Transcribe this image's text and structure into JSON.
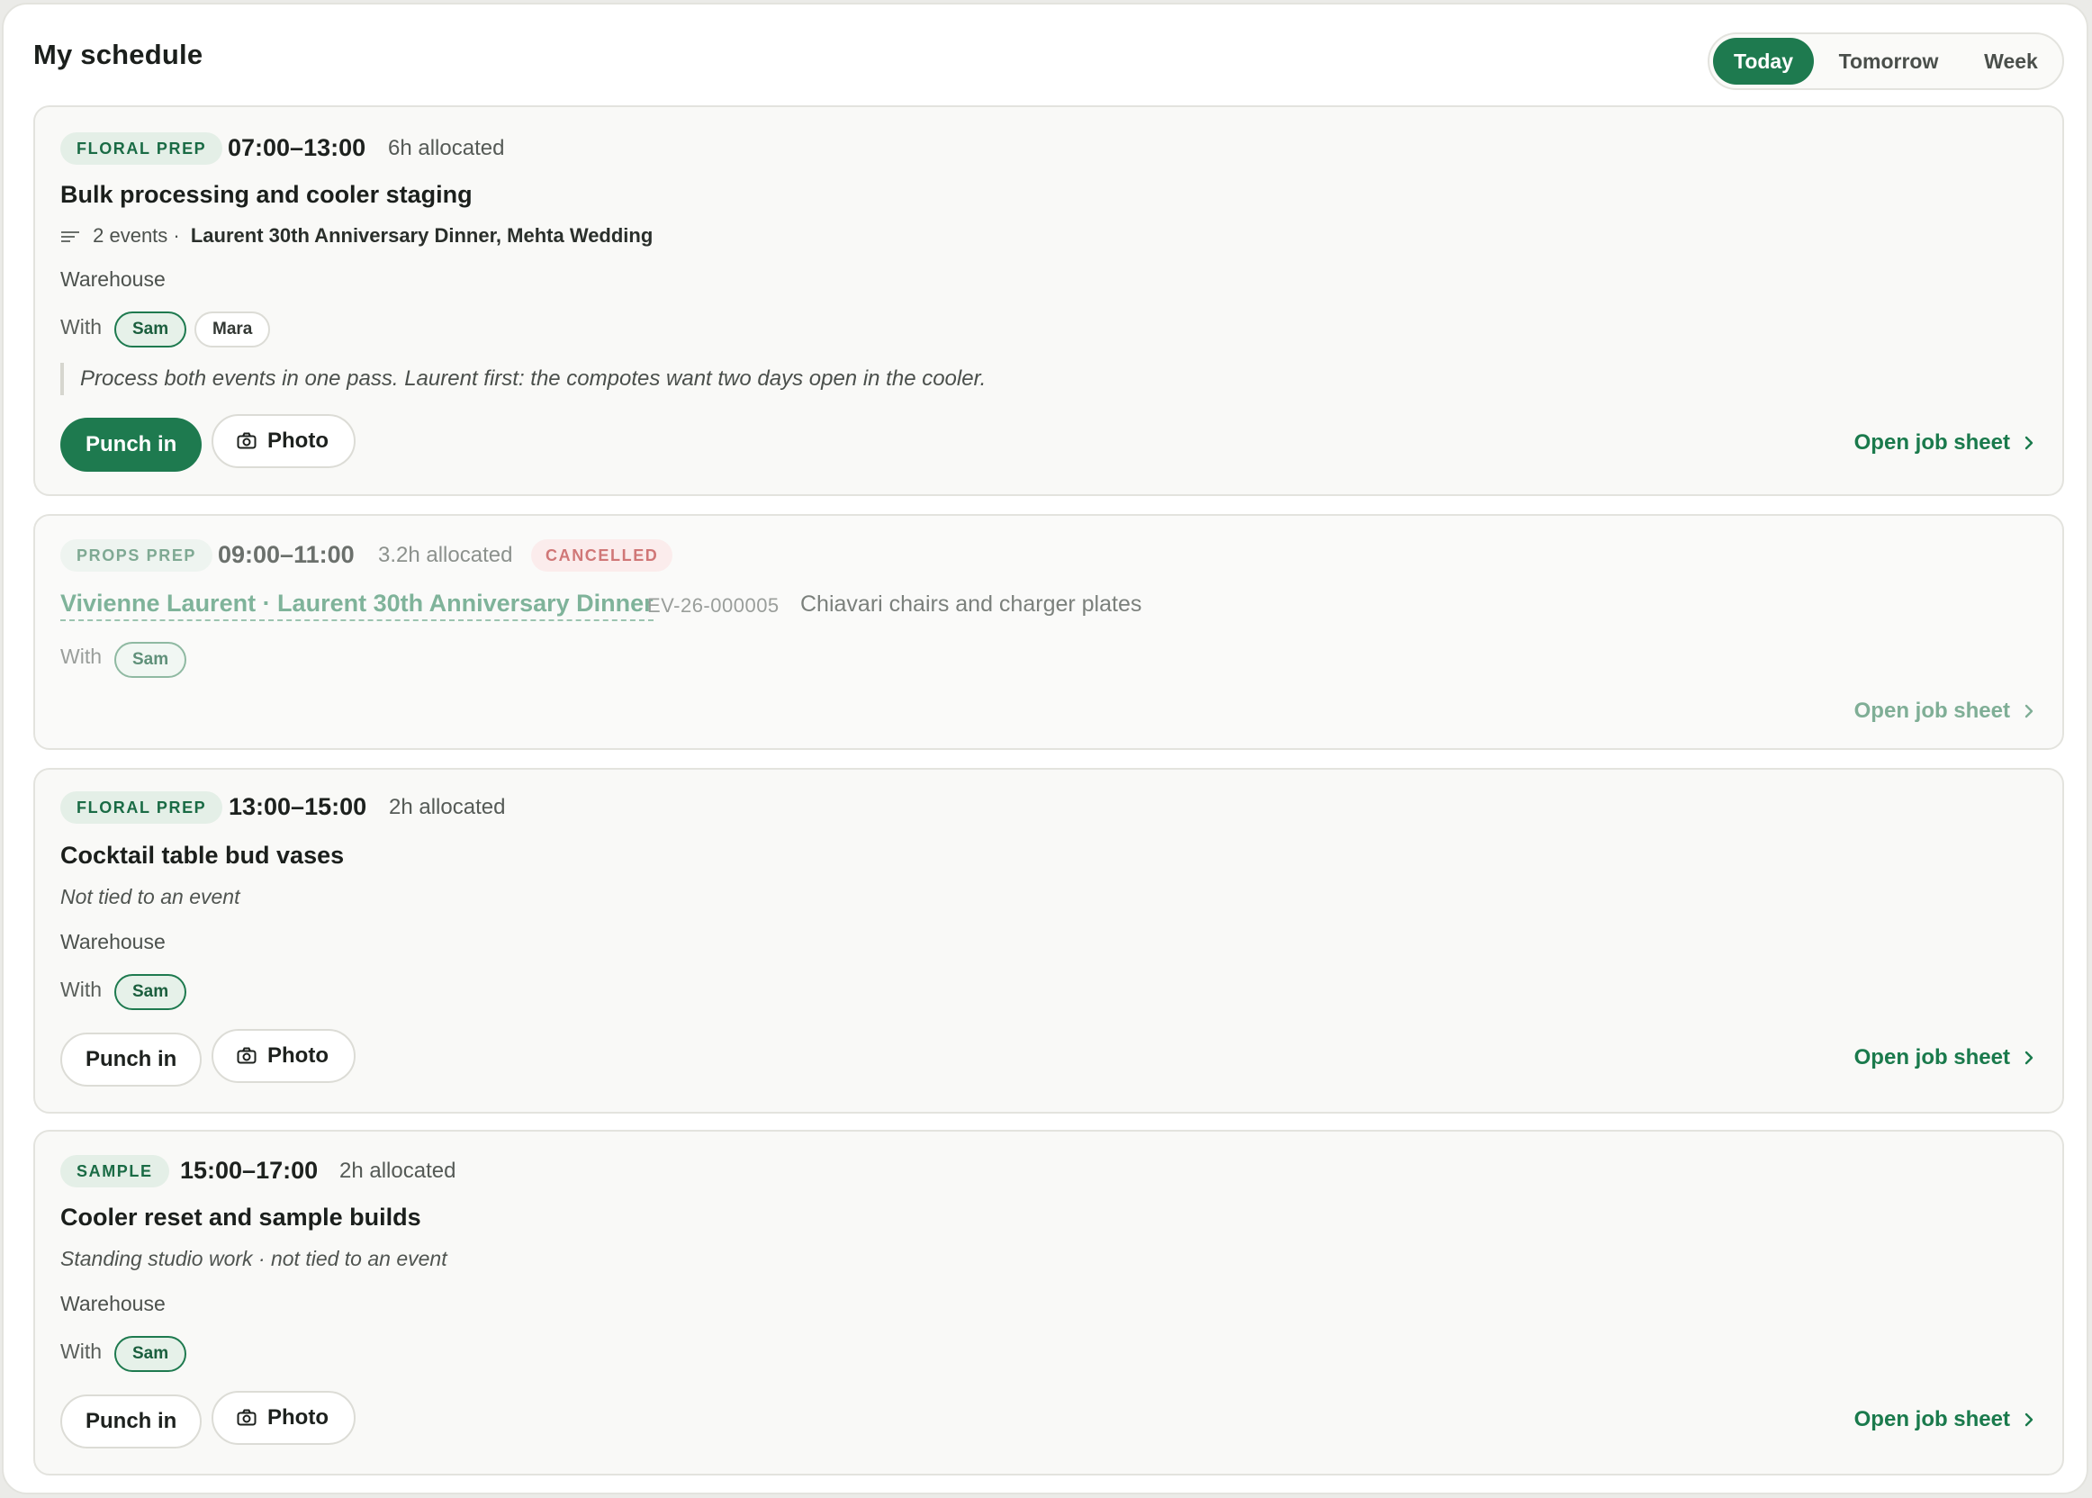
{
  "header": {
    "title": "My schedule"
  },
  "range_tabs": [
    {
      "label": "Today",
      "active": true
    },
    {
      "label": "Tomorrow",
      "active": false
    },
    {
      "label": "Week",
      "active": false
    }
  ],
  "common": {
    "with_label": "With",
    "punch_in": "Punch in",
    "photo": "Photo",
    "open_job_sheet": "Open job sheet"
  },
  "shifts": [
    {
      "tag": "FLORAL PREP",
      "time": "07:00–13:00",
      "allocated": "6h allocated",
      "title": "Bulk processing and cooler staging",
      "events_count": "2 events ·",
      "events_names": "Laurent 30th Anniversary Dinner, Mehta Wedding",
      "location": "Warehouse",
      "crew": [
        "Sam",
        "Mara"
      ],
      "note": "Process both events in one pass. Laurent first: the compotes want two days open in the cooler.",
      "punch_style": "primary"
    },
    {
      "tag": "PROPS PREP",
      "time": "09:00–11:00",
      "allocated": "3.2h allocated",
      "status": "CANCELLED",
      "event_link": "Vivienne Laurent · Laurent 30th Anniversary Dinner",
      "event_code": "EV-26-000005",
      "event_desc": "Chiavari chairs and charger plates",
      "crew": [
        "Sam"
      ]
    },
    {
      "tag": "FLORAL PREP",
      "time": "13:00–15:00",
      "allocated": "2h allocated",
      "title": "Cocktail table bud vases",
      "subtitle": "Not tied to an event",
      "location": "Warehouse",
      "crew": [
        "Sam"
      ],
      "punch_style": "outline"
    },
    {
      "tag": "SAMPLE",
      "time": "15:00–17:00",
      "allocated": "2h allocated",
      "title": "Cooler reset and sample builds",
      "subtitle": "Standing studio work · not tied to an event",
      "location": "Warehouse",
      "crew": [
        "Sam"
      ],
      "punch_style": "outline"
    }
  ],
  "colors": {
    "accent": "#1e7a4f",
    "cancelled": "#d07777",
    "card_bg": "#f9f9f7",
    "border": "#e3e3de"
  },
  "icons": [
    "list-lines-icon",
    "camera-icon",
    "chevron-right-icon"
  ]
}
